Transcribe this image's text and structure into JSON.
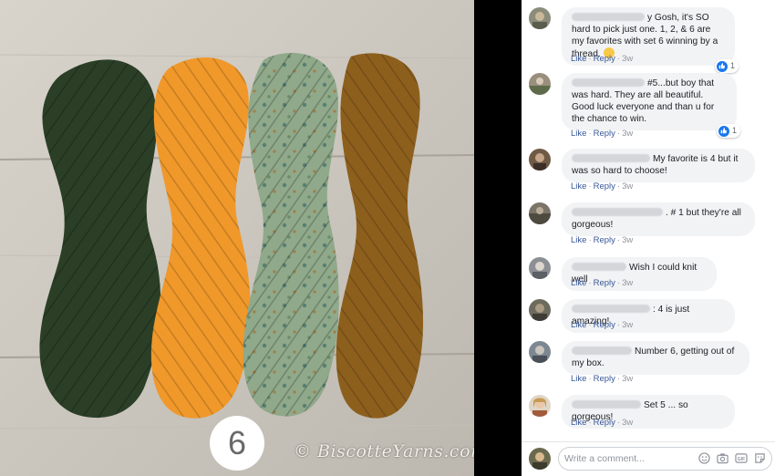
{
  "photo": {
    "badge_number": "6",
    "watermark": "© BiscotteYarns.com",
    "colors": {
      "wood": "#cfcbc3",
      "skein1": "#2b3f27",
      "skein2": "#f0982a",
      "skein3": "#8fa98a",
      "skein4": "#8d5f1d"
    }
  },
  "comments": [
    {
      "text": "y Gosh, it's SO hard to pick just one. 1, 2, & 6 are my favorites with set 6 winning by a thread.",
      "has_emoji": true,
      "reaction_count": "1",
      "like_label": "Like",
      "reply_label": "Reply",
      "time": "3w"
    },
    {
      "text": "#5...but boy that was hard. They are all beautiful. Good luck everyone and than u for the chance to win.",
      "reaction_count": "1",
      "like_label": "Like",
      "reply_label": "Reply",
      "time": "3w"
    },
    {
      "text": "My favorite is 4 but it was so hard to choose!",
      "like_label": "Like",
      "reply_label": "Reply",
      "time": "3w"
    },
    {
      "text": ". # 1 but they're all gorgeous!",
      "like_label": "Like",
      "reply_label": "Reply",
      "time": "3w"
    },
    {
      "text": "Wish I could knit well",
      "like_label": "Like",
      "reply_label": "Reply",
      "time": "3w"
    },
    {
      "text": ": 4 is just amazing!",
      "like_label": "Like",
      "reply_label": "Reply",
      "time": "3w"
    },
    {
      "text": "Number 6, getting out of my box.",
      "like_label": "Like",
      "reply_label": "Reply",
      "time": "3w"
    },
    {
      "text": "Set 5 ... so gorgeous!",
      "like_label": "Like",
      "reply_label": "Reply",
      "time": "3w"
    }
  ],
  "composer": {
    "placeholder": "Write a comment..."
  }
}
